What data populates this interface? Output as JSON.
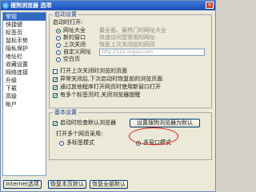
{
  "window": {
    "title": "搜狗浏览器 选项",
    "close_glyph": "×"
  },
  "sidebar": {
    "items": [
      {
        "label": "常规",
        "selected": true
      },
      {
        "label": "快捷键"
      },
      {
        "label": "标签页"
      },
      {
        "label": "鼠标手势"
      },
      {
        "label": "隐私保护"
      },
      {
        "label": "地址栏"
      },
      {
        "label": "收藏设置"
      },
      {
        "label": "网络连接"
      },
      {
        "label": "升级"
      },
      {
        "label": "下载"
      },
      {
        "label": "高级"
      },
      {
        "label": "帐户"
      }
    ]
  },
  "startup": {
    "legend": "启动设置",
    "open_label": "启动时打开:",
    "options": [
      {
        "label": "网址大全",
        "hint": "最全面、最热门的网址大全",
        "selected": true
      },
      {
        "label": "新的窗口",
        "hint": "快速访问您常用的网址"
      },
      {
        "label": "上次关闭",
        "hint": "恢复上次关闭前的网页"
      },
      {
        "label": "自定义网址",
        "hint": ""
      },
      {
        "label": "空白页",
        "hint": ""
      }
    ],
    "url_placeholder": "http://123.sogou.com",
    "checks": [
      {
        "label": "打开上次关闭时浏览的页面",
        "checked": false
      },
      {
        "label": "异常关闭后,下次启动时恢复前的浏览页面",
        "checked": true
      },
      {
        "label": "通过其他程序打开网页时使用新窗口打开",
        "checked": true
      },
      {
        "label": "有多个标签页时,关闭浏览器提醒",
        "checked": true
      }
    ]
  },
  "basic": {
    "legend": "基本设置",
    "check_default": "启动时检查默认浏览器",
    "check_default_checked": true,
    "set_default_button": "设置搜狗浏览器为默认",
    "multi_label": "打开多个网页采用:",
    "multi_options": [
      {
        "label": "多标签模式",
        "selected": false
      },
      {
        "label": "多窗口模式",
        "selected": true
      }
    ]
  },
  "footer": {
    "internet_options": "Internet选项",
    "restore_page": "恢复本页默认",
    "restore_all": "恢复全部默认"
  }
}
